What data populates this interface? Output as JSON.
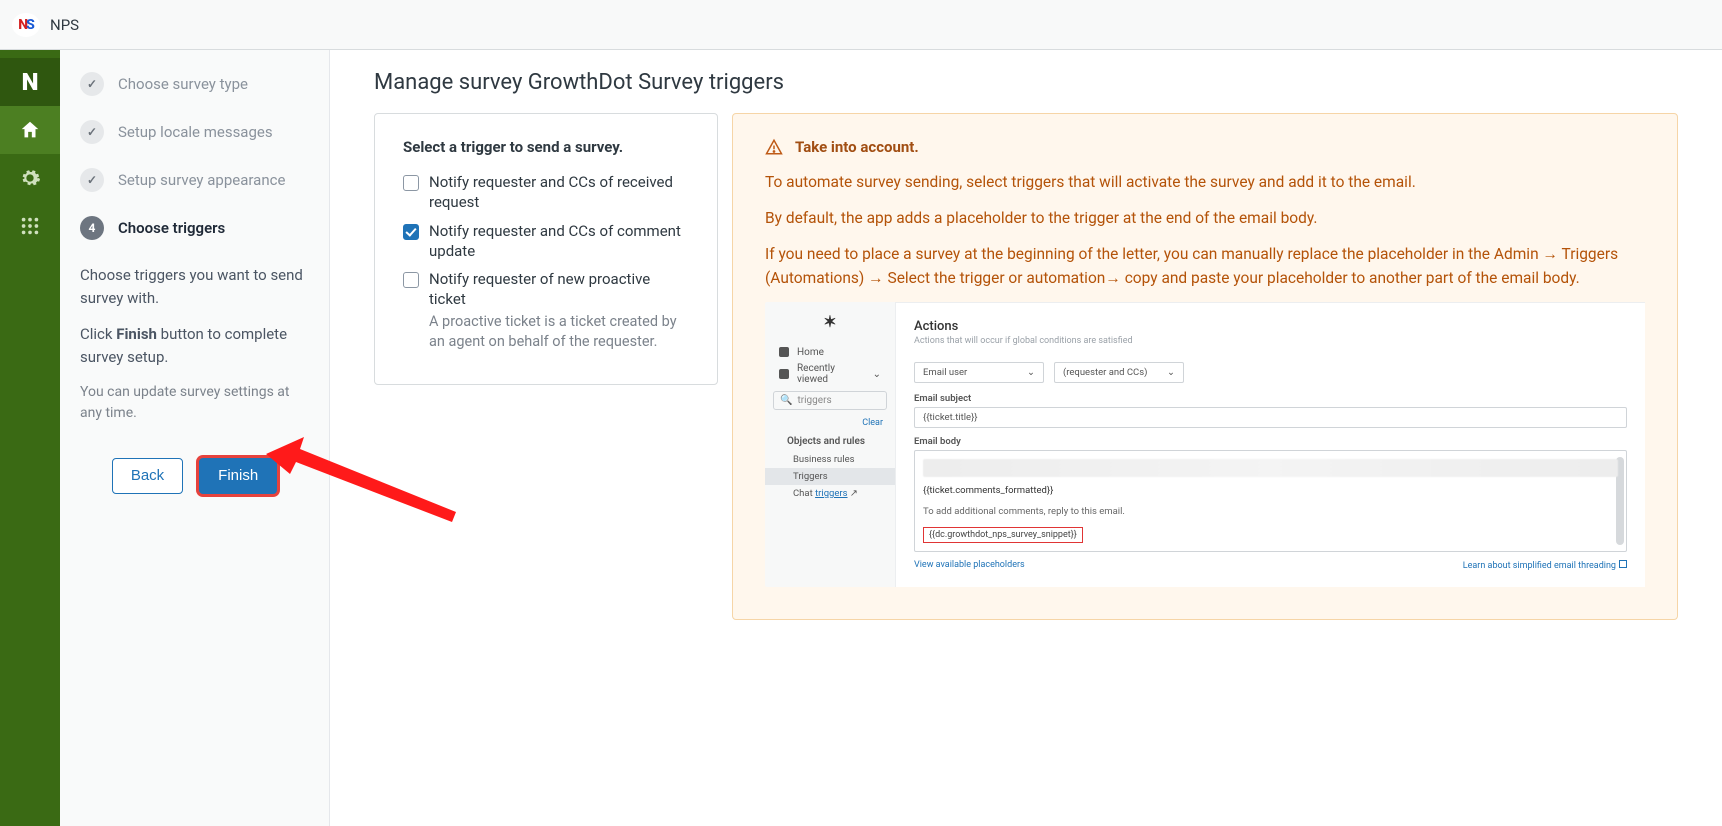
{
  "header": {
    "logo_n": "N",
    "logo_s": "S",
    "app_name": "NPS"
  },
  "rail": {
    "brand_letter": "N"
  },
  "steps": {
    "items": [
      {
        "label": "Choose survey type",
        "state": "done"
      },
      {
        "label": "Setup locale messages",
        "state": "done"
      },
      {
        "label": "Setup survey appearance",
        "state": "done"
      },
      {
        "label": "Choose triggers",
        "state": "current",
        "num": "4"
      }
    ],
    "help1": "Choose triggers you want to send survey with.",
    "help2_pre": "Click ",
    "help2_bold": "Finish",
    "help2_post": " button to complete survey setup.",
    "help3": "You can update survey settings at any time.",
    "back": "Back",
    "finish": "Finish"
  },
  "page": {
    "title": "Manage survey GrowthDot Survey triggers",
    "card_title": "Select a trigger to send a survey.",
    "triggers": [
      {
        "label": "Notify requester and CCs of received request",
        "checked": false
      },
      {
        "label": "Notify requester and CCs of comment update",
        "checked": true
      },
      {
        "label": "Notify requester of new proactive ticket",
        "checked": false,
        "sub": "A proactive ticket is a ticket created by an agent on behalf of the requester."
      }
    ]
  },
  "info": {
    "title": "Take into account.",
    "p1": "To automate survey sending, select triggers that will activate the survey and add it to the email.",
    "p2": "By default, the app adds a placeholder to the trigger at the end of the email body.",
    "p3": "If you need to place a survey at the beginning of the letter, you can manually replace the placeholder in the Admin → Triggers (Automations) → Select the trigger or automation→ copy and paste your placeholder to another part of the email body."
  },
  "mock": {
    "nav_home": "Home",
    "nav_recent": "Recently viewed",
    "search_value": "triggers",
    "clear": "Clear",
    "group": "Objects and rules",
    "sub1": "Business rules",
    "sub2": "Triggers",
    "sub3_pre": "Chat ",
    "sub3_link": "triggers",
    "actions": "Actions",
    "actions_cap": "Actions that will occur if global conditions are satisfied",
    "sel1": "Email user",
    "sel2": "(requester and CCs)",
    "lbl_subject": "Email subject",
    "val_subject": "{{ticket.title}}",
    "lbl_body": "Email body",
    "body_ph": "{{ticket.comments_formatted}}",
    "body_note": "To add additional comments, reply to this email.",
    "body_snippet": "{{dc.growthdot_nps_survey_snippet}}",
    "foot_left": "View available placeholders",
    "foot_right": "Learn about simplified email threading"
  }
}
